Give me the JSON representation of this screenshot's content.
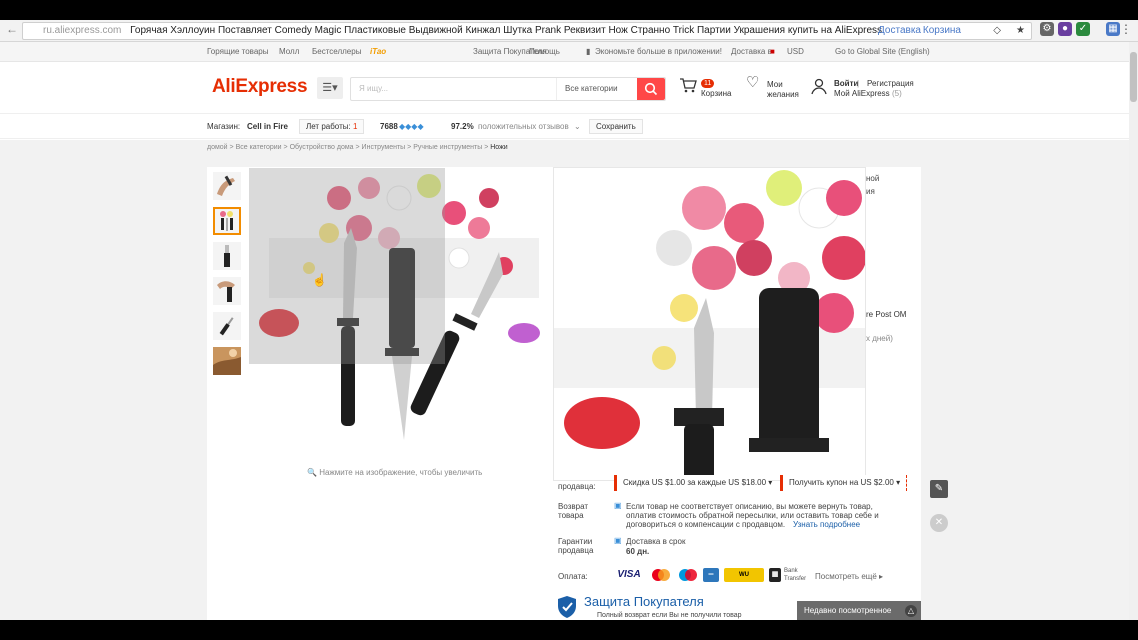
{
  "browser": {
    "url": "ru.aliexpress.com",
    "title": "Горячая Хэллоуин Поставляет Comedy Magic Пластиковые Выдвижной Кинжал Шутка Prank Реквизит Нож Странно Trick Партии Украшения купить на AliExpress",
    "right_link_1": "Доставка",
    "right_link_2": "Корзина"
  },
  "topbar": {
    "hot": "Горящие товары",
    "mall": "Молл",
    "bestsellers": "Бестселлеры",
    "tao": "iTao",
    "protection": "Защита Покупателя",
    "help": "Помощь",
    "app": "Экономьте больше в приложении!",
    "ship": "Доставка в",
    "currency": "USD",
    "global": "Go to Global Site (English)"
  },
  "header": {
    "logo": "AliExpress",
    "search_placeholder": "Я ищу...",
    "category": "Все категории",
    "cart_count": "11",
    "cart_label": "Корзина",
    "wish_label_1": "Мои",
    "wish_label_2": "желания",
    "login": "Войти",
    "register": "Регистрация",
    "my_ali": "Мой AliExpress",
    "my_ali_count": "(5)"
  },
  "store": {
    "store_label": "Магазин:",
    "store_name": "Cell in Fire",
    "years_label": "Лет работы:",
    "years": "1",
    "score": "7688",
    "percent": "97.2%",
    "positive": "положительных отзывов",
    "save": "Сохранить"
  },
  "breadcrumbs": {
    "home": "домой",
    "all": "Все категории",
    "c1": "Обустройство дома",
    "c2": "Инструменты",
    "c3": "Ручные инструменты",
    "current": "Ножи"
  },
  "gallery": {
    "zoom_hint": "Нажмите на изображение, чтобы увеличить"
  },
  "product_info": {
    "partial_1": "ной",
    "partial_2": "ия",
    "shipping_partial": "re Post OM",
    "days_partial": "х дней)",
    "coupon_1": "Скидка US $1.00 за каждые US $18.00",
    "coupon_2": "Получить купон на US $2.00",
    "coupon_label": "продавца:",
    "return_label_1": "Возврат",
    "return_label_2": "товара",
    "return_text_1": "Если товар не соответствует описанию, вы можете вернуть товар,",
    "return_text_2": "оплатив стоимость обратной пересылки, или оставить товар себе и",
    "return_text_3": "договориться о компенсации с продавцом.",
    "more_link": "Узнать подробнее",
    "guarantee_label_1": "Гарантии",
    "guarantee_label_2": "продавца",
    "guarantee_text": "Доставка в срок",
    "guarantee_days": "60 дн.",
    "payment_label": "Оплата:",
    "pay_more": "Посмотреть ещё",
    "bank_1": "Bank",
    "bank_2": "Transfer",
    "buyer_protection": "Защита Покупателя",
    "bp_sub": "Полный возврат если Вы не получили товар"
  },
  "recent": {
    "label": "Недавно посмотренное"
  },
  "colors": {
    "brand": "#e62e04",
    "search_button": "#ff4747",
    "thumb_active": "#f28c00",
    "link": "#1b5fa8"
  }
}
